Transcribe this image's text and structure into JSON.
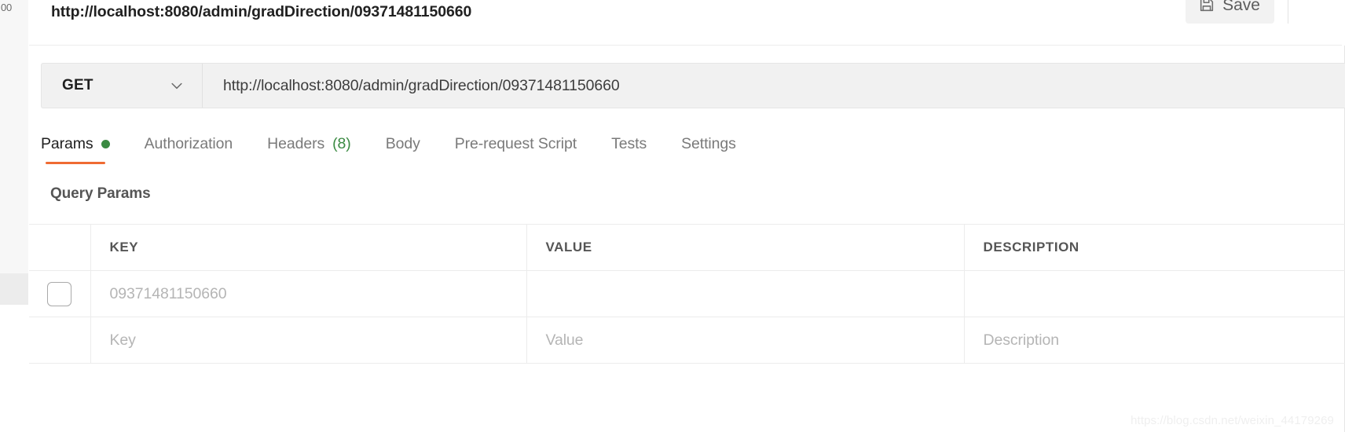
{
  "request": {
    "title": "http://localhost:8080/admin/gradDirection/09371481150660",
    "method": "GET",
    "url": "http://localhost:8080/admin/gradDirection/09371481150660",
    "method_icon": "chevron-down-icon"
  },
  "sidebar": {
    "breadcrumb_fragment": "00"
  },
  "toolbar": {
    "save_label": "Save",
    "save_icon": "floppy-disk-icon"
  },
  "tabs": [
    {
      "label": "Params",
      "active": true,
      "indicator": "dot",
      "count": ""
    },
    {
      "label": "Authorization",
      "active": false,
      "indicator": "",
      "count": ""
    },
    {
      "label": "Headers",
      "active": false,
      "indicator": "count",
      "count": "(8)"
    },
    {
      "label": "Body",
      "active": false,
      "indicator": "",
      "count": ""
    },
    {
      "label": "Pre-request Script",
      "active": false,
      "indicator": "",
      "count": ""
    },
    {
      "label": "Tests",
      "active": false,
      "indicator": "",
      "count": ""
    },
    {
      "label": "Settings",
      "active": false,
      "indicator": "",
      "count": ""
    }
  ],
  "params": {
    "section_title": "Query Params",
    "columns": [
      "KEY",
      "VALUE",
      "DESCRIPTION"
    ],
    "rows": [
      {
        "checked": false,
        "key": "09371481150660",
        "value": "",
        "description": "",
        "is_placeholder_row": false
      },
      {
        "checked": false,
        "key": "Key",
        "value": "Value",
        "description": "Description",
        "is_placeholder_row": true
      }
    ]
  },
  "watermark": {
    "text": "https://blog.csdn.net/weixin_44179269"
  },
  "colors": {
    "accent_orange": "#ef6b33",
    "indicator_green": "#3a8a42",
    "field_background": "#f1f1f1",
    "save_background": "#f2f2f2"
  }
}
